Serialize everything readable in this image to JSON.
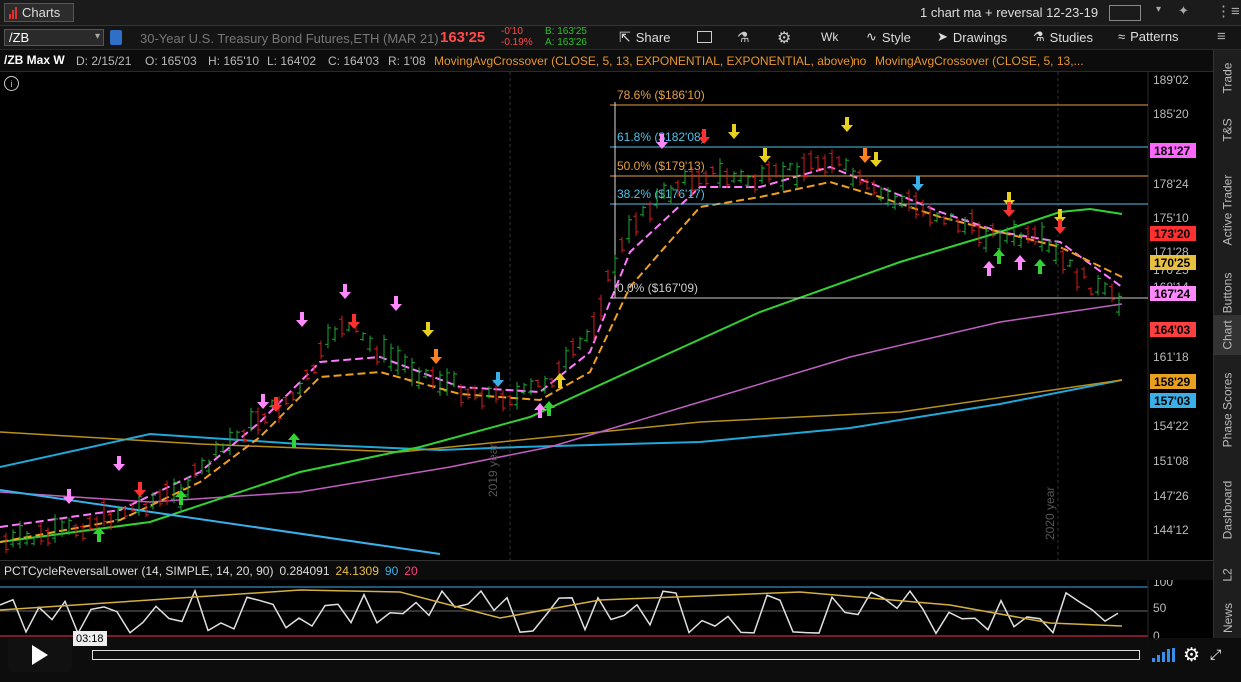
{
  "topbar": {
    "charts_tab": "Charts",
    "layout_title": "1 chart ma + reversal 12-23-19"
  },
  "symbar": {
    "symbol": "/ZB",
    "description": "30-Year U.S. Treasury Bond Futures,ETH (MAR 21)",
    "last_price": "163'25",
    "net_change": "-0'10",
    "pct_change": "-0.19%",
    "bid": "B: 163'25",
    "ask": "A: 163'26",
    "share": "Share",
    "period": "Wk",
    "style": "Style",
    "drawings": "Drawings",
    "studies": "Studies",
    "patterns": "Patterns"
  },
  "studybar": {
    "chart_name": "/ZB Max W",
    "date": "D: 2/15/21",
    "open": "O: 165'03",
    "high": "H: 165'10",
    "low": "L: 164'02",
    "close": "C: 164'03",
    "range": "R: 1'08",
    "study1": "MovingAvgCrossover (CLOSE, 5, 13, EXPONENTIAL, EXPONENTIAL, above)",
    "study1_flag": "no",
    "study2": "MovingAvgCrossover (CLOSE, 5, 13,..."
  },
  "chart": {
    "fib_levels": [
      {
        "label": "78.6%",
        "value": "($186'10)",
        "color": "#e6a040"
      },
      {
        "label": "61.8%",
        "value": "($182'08)",
        "color": "#4fc3e8"
      },
      {
        "label": "50.0%",
        "value": "($179'13)",
        "color": "#e6a040"
      },
      {
        "label": "38.2%",
        "value": "($176'17)",
        "color": "#4fc3e8"
      },
      {
        "label": "0.0%",
        "value": "($167'09)",
        "color": "#cccccc"
      }
    ],
    "price_ticks": [
      "189'02",
      "185'20",
      "181'27",
      "178'24",
      "175'10",
      "171'28",
      "170'25",
      "168'14",
      "164'03",
      "161'18",
      "158'29",
      "157'03",
      "154'22",
      "151'08",
      "147'26",
      "144'12"
    ],
    "price_tags": [
      {
        "text": "181'27",
        "color": "#ff66ff"
      },
      {
        "text": "173'20",
        "color": "#ff3030"
      },
      {
        "text": "170'25",
        "color": "#e8c040"
      },
      {
        "text": "167'24",
        "color": "#ff88ff"
      },
      {
        "text": "164'03",
        "color": "#ff4040"
      },
      {
        "text": "158'29",
        "color": "#e8a020"
      },
      {
        "text": "157'03",
        "color": "#3ab0e8"
      }
    ],
    "year_markers": [
      "2019 year",
      "2020 year"
    ]
  },
  "lower": {
    "study": "PCTCycleReversalLower (14, SIMPLE, 14, 20, 90)",
    "value1": "0.284091",
    "value2": "24.1309",
    "value3": "90",
    "value4": "20",
    "ticks": [
      "100",
      "50",
      "0"
    ]
  },
  "player": {
    "time": "03:18"
  },
  "rightnav": [
    "Trade",
    "T&S",
    "Active Trader",
    "Buttons",
    "Chart",
    "Phase Scores",
    "Dashboard",
    "L2",
    "News"
  ],
  "colors": {
    "up": "#1fa83a",
    "down": "#d02020",
    "ema_fast": "#ff7aff",
    "ema_slow": "#f0a020",
    "sma_green": "#32d232",
    "sma_violet": "#c060c0",
    "sma_cyan": "#2aa8d8"
  }
}
